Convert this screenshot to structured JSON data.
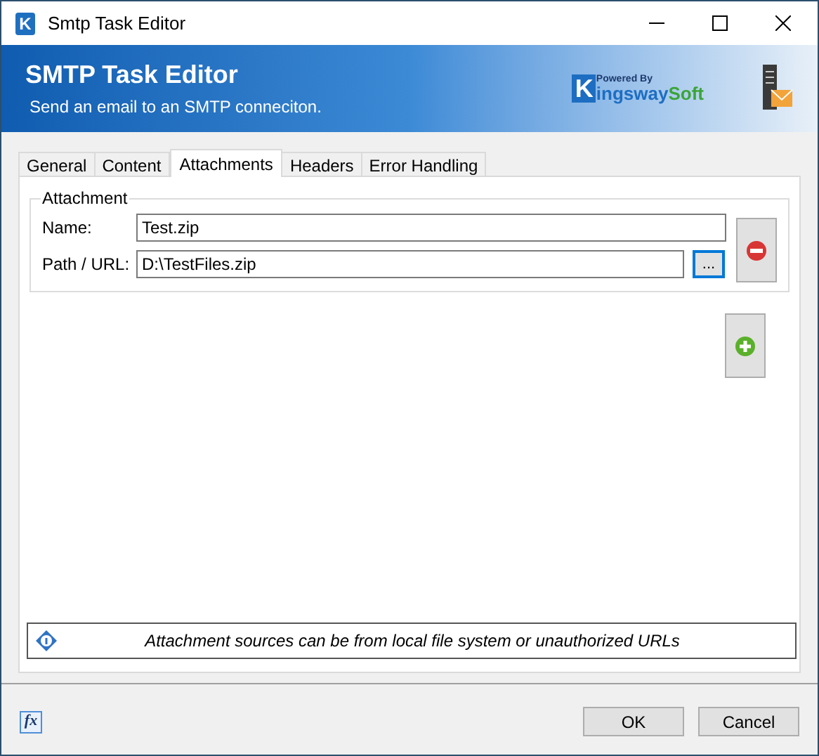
{
  "window": {
    "app_icon": "K",
    "title": "Smtp Task Editor"
  },
  "banner": {
    "title": "SMTP Task Editor",
    "subtitle": "Send an email to an SMTP conneciton.",
    "logo": {
      "powered_by": "Powered By",
      "initial": "K",
      "name": "ingsway",
      "suffix": "Soft"
    }
  },
  "tabs": [
    {
      "label": "General",
      "selected": false
    },
    {
      "label": "Content",
      "selected": false
    },
    {
      "label": "Attachments",
      "selected": true
    },
    {
      "label": "Headers",
      "selected": false
    },
    {
      "label": "Error Handling",
      "selected": false
    }
  ],
  "attachment": {
    "legend": "Attachment",
    "name_label": "Name:",
    "name_value": "Test.zip",
    "path_label": "Path / URL:",
    "path_value": "D:\\TestFiles.zip",
    "browse_button": "..."
  },
  "info": "Attachment sources can be from local file system or unauthorized URLs",
  "footer": {
    "fx": "fx",
    "buttons": [
      "OK",
      "Cancel"
    ]
  }
}
